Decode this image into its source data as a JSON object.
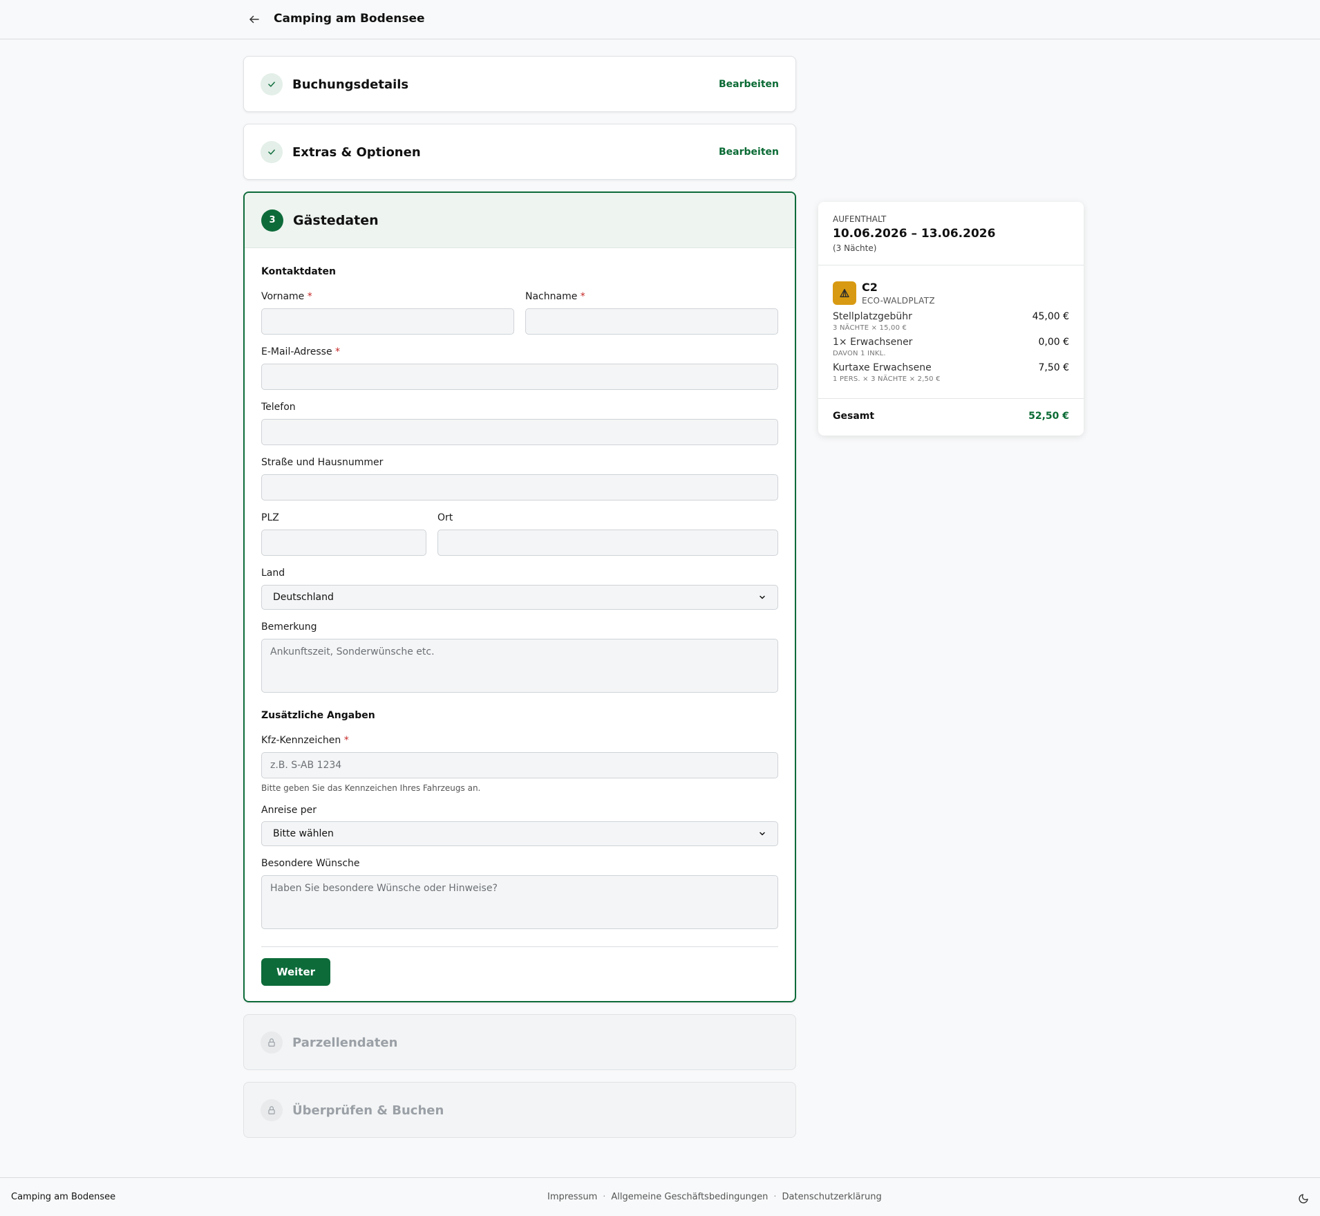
{
  "header": {
    "title": "Camping am Bodensee",
    "back_icon": "arrow-left-icon"
  },
  "steps": {
    "booking": {
      "title": "Buchungsdetails",
      "edit": "Bearbeiten"
    },
    "extras": {
      "title": "Extras & Optionen",
      "edit": "Bearbeiten"
    },
    "guest": {
      "number": "3",
      "title": "Gästedaten"
    },
    "pitch": {
      "title": "Parzellendaten"
    },
    "review": {
      "title": "Überprüfen & Buchen"
    }
  },
  "form": {
    "contact_title": "Kontaktdaten",
    "firstname_label": "Vorname",
    "lastname_label": "Nachname",
    "email_label": "E-Mail-Adresse",
    "phone_label": "Telefon",
    "street_label": "Straße und Hausnummer",
    "zip_label": "PLZ",
    "city_label": "Ort",
    "country_label": "Land",
    "country_value": "Deutschland",
    "remark_label": "Bemerkung",
    "remark_placeholder": "Ankunftszeit, Sonderwünsche etc.",
    "additional_title": "Zusätzliche Angaben",
    "plate_label": "Kfz-Kennzeichen",
    "plate_placeholder": "z.B. S-AB 1234",
    "plate_hint": "Bitte geben Sie das Kennzeichen Ihres Fahrzeugs an.",
    "arrival_label": "Anreise per",
    "arrival_value": "Bitte wählen",
    "wishes_label": "Besondere Wünsche",
    "wishes_placeholder": "Haben Sie besondere Wünsche oder Hinweise?",
    "required_mark": "*",
    "next_button": "Weiter"
  },
  "summary": {
    "stay_label": "AUFENTHALT",
    "dates": "10.06.2026 – 13.06.2026",
    "nights": "(3 Nächte)",
    "pitch_name": "C2",
    "pitch_type": "ECO-WALDPLATZ",
    "items": [
      {
        "label": "Stellplatzgebühr",
        "sub": "3 NÄCHTE × 15,00 €",
        "price": "45,00 €"
      },
      {
        "label": "1× Erwachsener",
        "sub": "DAVON 1 INKL.",
        "price": "0,00 €"
      },
      {
        "label": "Kurtaxe Erwachsene",
        "sub": "1 PERS. × 3 NÄCHTE × 2,50 €",
        "price": "7,50 €"
      }
    ],
    "total_label": "Gesamt",
    "total_value": "52,50 €"
  },
  "footer": {
    "brand": "Camping am Bodensee",
    "links": [
      "Impressum",
      "Allgemeine Geschäftsbedingungen",
      "Datenschutzerklärung"
    ],
    "separator": "·"
  },
  "colors": {
    "primary": "#0d6b3a",
    "accent_green": "#0a6a34",
    "pitch_icon": "#d89a12",
    "required": "#c62828"
  }
}
